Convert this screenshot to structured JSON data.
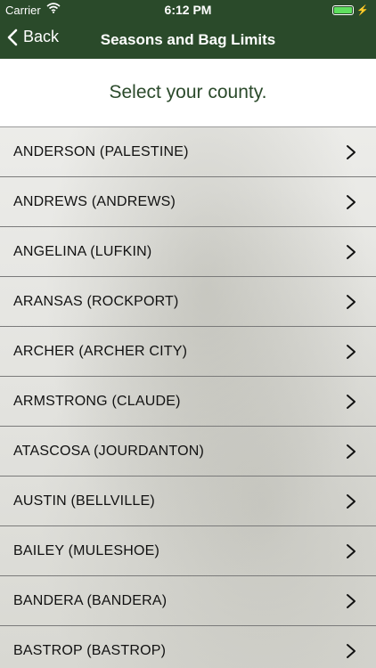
{
  "status": {
    "carrier": "Carrier",
    "time": "6:12 PM"
  },
  "nav": {
    "back_label": "Back",
    "title": "Seasons and Bag Limits"
  },
  "prompt": "Select your county.",
  "counties": [
    "ANDERSON (PALESTINE)",
    "ANDREWS (ANDREWS)",
    "ANGELINA (LUFKIN)",
    "ARANSAS (ROCKPORT)",
    "ARCHER (ARCHER CITY)",
    "ARMSTRONG (CLAUDE)",
    "ATASCOSA (JOURDANTON)",
    "AUSTIN (BELLVILLE)",
    "BAILEY (MULESHOE)",
    "BANDERA (BANDERA)",
    "BASTROP (BASTROP)"
  ],
  "colors": {
    "header": "#2a4a2a",
    "prompt_text": "#2b4a2b",
    "battery": "#5ede5e"
  },
  "icons": {
    "wifi": "wifi-icon",
    "battery": "battery-icon",
    "back": "back-chevron-icon",
    "row": "chevron-right-icon"
  }
}
